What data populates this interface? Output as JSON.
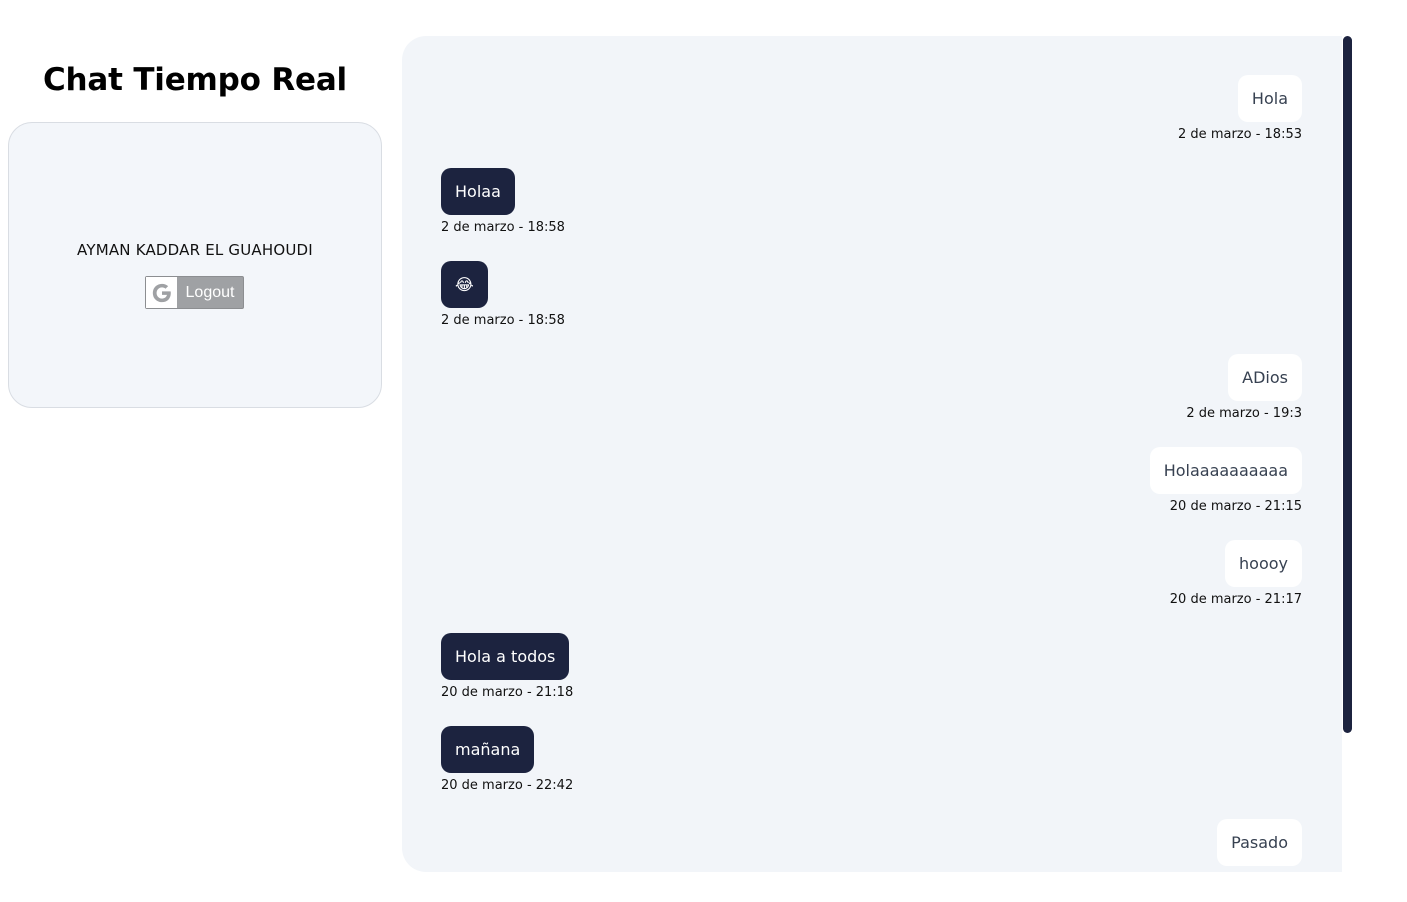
{
  "app": {
    "title": "Chat Tiempo Real"
  },
  "profile": {
    "user_name": "AYMAN KADDAR EL GUAHOUDI",
    "logout_label": "Logout",
    "provider_icon": "google-icon"
  },
  "colors": {
    "sent_bubble": "#ffffff",
    "received_bubble": "#1c233f",
    "panel_bg": "#f2f5f9",
    "accent": "#1c233f"
  },
  "messages": [
    {
      "side": "sent",
      "text": "Hola",
      "time": "2 de marzo - 18:53"
    },
    {
      "side": "received",
      "text": "Holaa",
      "time": "2 de marzo - 18:58"
    },
    {
      "side": "received",
      "text": "😂",
      "time": "2 de marzo - 18:58"
    },
    {
      "side": "sent",
      "text": "ADios",
      "time": "2 de marzo - 19:3"
    },
    {
      "side": "sent",
      "text": "Holaaaaaaaaaa",
      "time": "20 de marzo - 21:15"
    },
    {
      "side": "sent",
      "text": "hoooy",
      "time": "20 de marzo - 21:17"
    },
    {
      "side": "received",
      "text": "Hola a todos",
      "time": "20 de marzo - 21:18"
    },
    {
      "side": "received",
      "text": "mañana",
      "time": "20 de marzo - 22:42"
    },
    {
      "side": "sent",
      "text": "Pasado",
      "time": ""
    }
  ]
}
